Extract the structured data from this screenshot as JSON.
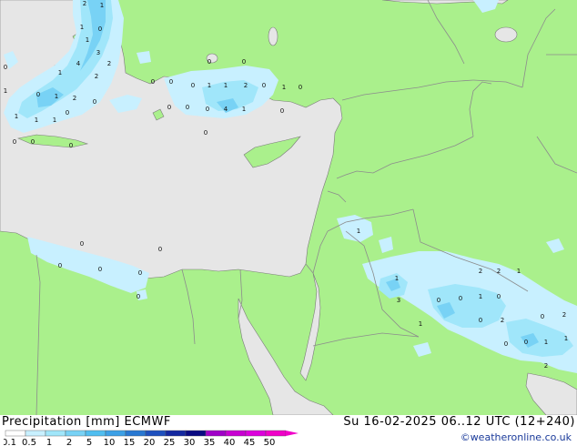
{
  "legend": {
    "title": "Precipitation [mm]",
    "model": "ECMWF",
    "datetime": "Su 16-02-2025 06..12 UTC (12+240)",
    "credit": "©weatheronline.co.uk",
    "scale_labels": [
      "0.1",
      "0.5",
      "1",
      "2",
      "5",
      "10",
      "15",
      "20",
      "25",
      "30",
      "35",
      "40",
      "45",
      "50"
    ],
    "scale_colors": [
      "#ffffff",
      "#c8f0ff",
      "#a0e6fa",
      "#78d2f5",
      "#50bef0",
      "#3ca0e6",
      "#2878d2",
      "#1e50be",
      "#1428a0",
      "#0a0a82",
      "#a000c8",
      "#c800d2",
      "#dc00dc",
      "#f000c8"
    ]
  },
  "map_colors": {
    "land": "#aaf08c",
    "sea": "#e6e6e6",
    "border": "#8c8c8c",
    "coast": "#7a7a7a"
  },
  "precip_values": [
    "2",
    "1",
    "1",
    "0",
    "1",
    "3",
    "2",
    "4",
    "2",
    "0",
    "1",
    "0",
    "1",
    "2",
    "0",
    "1",
    "1",
    "1",
    "0",
    "0",
    "0",
    "0",
    "0",
    "0",
    "0",
    "0",
    "1",
    "1",
    "2",
    "0",
    "1",
    "0",
    "0",
    "0",
    "0",
    "4",
    "1",
    "0",
    "0",
    "1",
    "0",
    "0",
    "0",
    "0",
    "0",
    "0",
    "1",
    "3",
    "0",
    "0",
    "1",
    "0",
    "2",
    "2",
    "1",
    "1",
    "0",
    "2",
    "0",
    "2",
    "0",
    "0",
    "1",
    "1",
    "2",
    "1",
    "0"
  ]
}
